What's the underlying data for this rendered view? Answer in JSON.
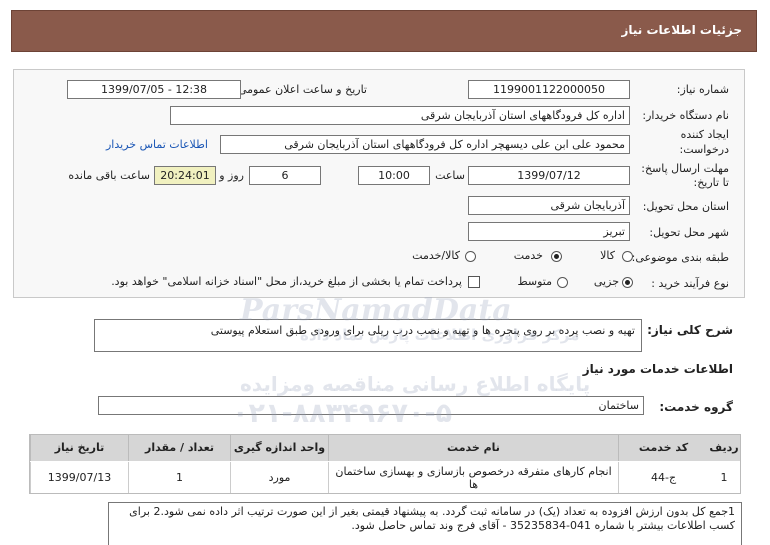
{
  "header": {
    "title": "جزئیات اطلاعات نیاز"
  },
  "form": {
    "need_number_label": "شماره نیاز:",
    "need_number": "1199001122000050",
    "announce_label": "تاریخ و ساعت اعلان عمومی:",
    "announce_value": "1399/07/05 - 12:38",
    "buyer_label": "نام دستگاه خریدار:",
    "buyer_value": "اداره کل فرودگاههای استان آذربایجان شرقی",
    "creator_label_1": "ایجاد کننده",
    "creator_label_2": "درخواست:",
    "creator_value": "محمود علی ابن علی دیسهچر اداره کل فرودگاههای استان آذربایجان شرقی",
    "contact_link": "اطلاعات تماس خریدار",
    "deadline_label_1": "مهلت ارسال پاسخ:",
    "deadline_label_2": "تا تاریخ:",
    "deadline_date": "1399/07/12",
    "time_label": "ساعت",
    "deadline_time": "10:00",
    "days_value": "6",
    "days_label": "روز و",
    "remaining_value": "20:24:01",
    "remaining_label": "ساعت باقی مانده",
    "province_label": "استان محل تحویل:",
    "province_value": "آذربایجان شرقی",
    "city_label": "شهر محل تحویل:",
    "city_value": "تبریز",
    "category_label": "طبقه بندی موضوعی:",
    "category_options": [
      "کالا",
      "خدمت",
      "کالا/خدمت"
    ],
    "category_selected": "خدمت",
    "process_label": "نوع فرآیند خرید :",
    "process_options": [
      "جزیی",
      "متوسط"
    ],
    "process_selected": "جزیی",
    "treasury_note": "پرداخت تمام یا بخشی از مبلغ خرید،از محل \"اسناد خزانه اسلامی\" خواهد بود."
  },
  "description": {
    "label": "شرح کلی نیاز:",
    "text": "تهیه و نصب پرده بر روی پنجره ها و تهیه و نصب درب ریلی برای ورودی طبق استعلام پیوستی"
  },
  "services": {
    "section_title": "اطلاعات خدمات مورد نیاز",
    "group_label": "گروه خدمت:",
    "group_value": "ساختمان",
    "columns": [
      "ردیف",
      "کد خدمت",
      "نام خدمت",
      "واحد اندازه گیری",
      "تعداد / مقدار",
      "تاریخ نیاز"
    ],
    "rows": [
      {
        "row": "1",
        "code": "ج-44",
        "name": "انجام کارهای متفرقه درخصوص بازسازی و بهسازی ساختمان ها",
        "unit": "مورد",
        "qty": "1",
        "date": "1399/07/13"
      }
    ]
  },
  "notes": {
    "text": "1جمع کل بدون ارزش افزوده به تعداد (یک) در سامانه ثبت گردد. به پیشنهاد قیمتی بغیر از این صورت ترتیب اثر داده نمی شود.2 برای کسب اطلاعات بیشتر با شماره 041-35235834 - آقای فرج وند تماس حاصل شود."
  },
  "watermark": {
    "line1": "ParsNamadData",
    "line2": "مرکز فراوری اطلاعات پارس نماد داده",
    "line3": "پایگاه اطلاع رسانی مناقصه ومزایده",
    "line4": "۰۲۱-۸۸۳۴۹۶۷۰-۵"
  },
  "colors": {
    "header_bg": "#8a5a4b",
    "remaining_bg": "#f1f1c0",
    "table_header_bg": "#d6d6d6",
    "link": "#1a56b5"
  }
}
